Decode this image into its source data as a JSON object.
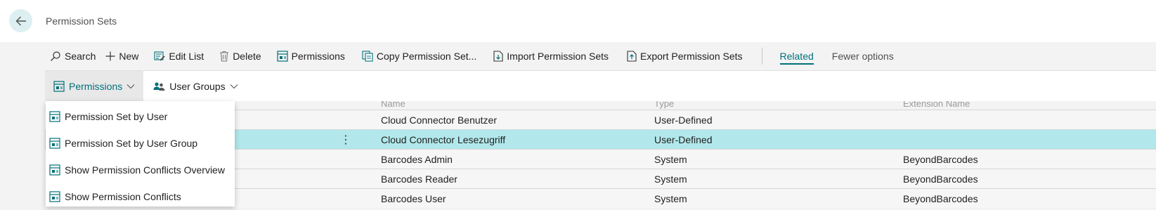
{
  "header": {
    "title": "Permission Sets"
  },
  "actions": {
    "search": "Search",
    "new": "New",
    "edit_list": "Edit List",
    "delete": "Delete",
    "permissions": "Permissions",
    "copy": "Copy Permission Set...",
    "import": "Import Permission Sets",
    "export": "Export Permission Sets",
    "related": "Related",
    "fewer": "Fewer options"
  },
  "subtabs": {
    "permissions": "Permissions",
    "user_groups": "User Groups"
  },
  "menu": {
    "items": [
      {
        "label": "Permission Set by User"
      },
      {
        "label": "Permission Set by User Group"
      },
      {
        "label": "Show Permission Conflicts Overview"
      },
      {
        "label": "Show Permission Conflicts"
      }
    ]
  },
  "table": {
    "columns": {
      "name": "Name",
      "type": "Type",
      "extension": "Extension Name"
    },
    "rows": [
      {
        "name": "Cloud Connector Benutzer",
        "type": "User-Defined",
        "extension": ""
      },
      {
        "name": "Cloud Connector Lesezugriff",
        "type": "User-Defined",
        "extension": "",
        "selected": true
      },
      {
        "name": "Barcodes Admin",
        "type": "System",
        "extension": "BeyondBarcodes"
      },
      {
        "name": "Barcodes Reader",
        "type": "System",
        "extension": "BeyondBarcodes"
      },
      {
        "name": "Barcodes User",
        "type": "System",
        "extension": "BeyondBarcodes"
      }
    ]
  },
  "colors": {
    "accent": "#00707a",
    "selected_row": "#b2e8eb",
    "back_button_bg": "#ddeff0"
  }
}
